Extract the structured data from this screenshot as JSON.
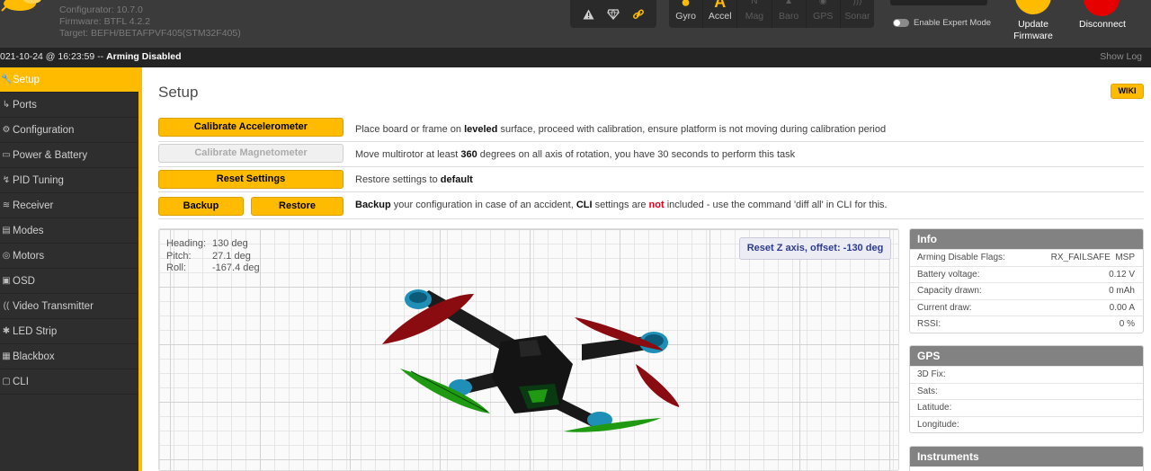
{
  "app": {
    "configurator_version": "Configurator: 10.7.0",
    "firmware": "Firmware: BTFL 4.2.2",
    "target": "Target: BEFH/BETAFPVF405(STM32F405)"
  },
  "header": {
    "status_icons": [
      "warning-icon",
      "shield-icon",
      "link-icon"
    ],
    "sensors": [
      {
        "label": "Gyro",
        "active": true
      },
      {
        "label": "Accel",
        "active": true
      },
      {
        "label": "Mag",
        "active": false
      },
      {
        "label": "Baro",
        "active": false
      },
      {
        "label": "GPS",
        "active": false
      },
      {
        "label": "Sonar",
        "active": false
      }
    ],
    "expert_mode_label": "Enable Expert Mode",
    "update_firmware_label_1": "Update",
    "update_firmware_label_2": "Firmware",
    "disconnect_label": "Disconnect"
  },
  "statusbar": {
    "log_timestamp": "021-10-24 @ 16:23:59 -- ",
    "log_message": "Arming Disabled",
    "show_log": "Show Log"
  },
  "sidebar": {
    "items": [
      {
        "label": "Setup",
        "icon": "wrench-icon",
        "glyph": "🔧",
        "active": true
      },
      {
        "label": "Ports",
        "icon": "ports-icon",
        "glyph": "↳",
        "active": false
      },
      {
        "label": "Configuration",
        "icon": "gear-icon",
        "glyph": "⚙",
        "active": false
      },
      {
        "label": "Power & Battery",
        "icon": "battery-icon",
        "glyph": "▭",
        "active": false
      },
      {
        "label": "PID Tuning",
        "icon": "pid-icon",
        "glyph": "↯",
        "active": false
      },
      {
        "label": "Receiver",
        "icon": "receiver-icon",
        "glyph": "≋",
        "active": false
      },
      {
        "label": "Modes",
        "icon": "modes-icon",
        "glyph": "▤",
        "active": false
      },
      {
        "label": "Motors",
        "icon": "motor-icon",
        "glyph": "◎",
        "active": false
      },
      {
        "label": "OSD",
        "icon": "osd-icon",
        "glyph": "▣",
        "active": false
      },
      {
        "label": "Video Transmitter",
        "icon": "vtx-icon",
        "glyph": "((",
        "active": false
      },
      {
        "label": "LED Strip",
        "icon": "led-icon",
        "glyph": "✱",
        "active": false
      },
      {
        "label": "Blackbox",
        "icon": "blackbox-icon",
        "glyph": "▦",
        "active": false
      },
      {
        "label": "CLI",
        "icon": "cli-icon",
        "glyph": "▢",
        "active": false
      }
    ]
  },
  "setup": {
    "title": "Setup",
    "wiki_label": "WIKI",
    "calibrate_acc_label": "Calibrate Accelerometer",
    "calibrate_acc_desc_1": "Place board or frame on ",
    "calibrate_acc_desc_bold": "leveled",
    "calibrate_acc_desc_2": " surface, proceed with calibration, ensure platform is not moving during calibration period",
    "calibrate_mag_label": "Calibrate Magnetometer",
    "calibrate_mag_desc_1": "Move multirotor at least ",
    "calibrate_mag_desc_bold": "360",
    "calibrate_mag_desc_2": " degrees on all axis of rotation, you have 30 seconds to perform this task",
    "reset_label": "Reset Settings",
    "reset_desc_1": "Restore settings to ",
    "reset_desc_bold": "default",
    "backup_label": "Backup",
    "restore_label": "Restore",
    "backup_desc_b1": "Backup",
    "backup_desc_1": " your configuration in case of an accident, ",
    "backup_desc_b2": "CLI",
    "backup_desc_2": " settings are ",
    "backup_desc_not": "not",
    "backup_desc_3": " included - use the command 'diff all' in CLI for this."
  },
  "attitude": {
    "heading_label": "Heading:",
    "heading_value": "130 deg",
    "pitch_label": "Pitch:",
    "pitch_value": "27.1 deg",
    "roll_label": "Roll:",
    "roll_value": "-167.4 deg",
    "reset_z_label": "Reset Z axis, offset: -130 deg"
  },
  "info": {
    "title": "Info",
    "rows": [
      {
        "label": "Arming Disable Flags:",
        "value": "RX_FAILSAFE  MSP"
      },
      {
        "label": "Battery voltage:",
        "value": "0.12 V"
      },
      {
        "label": "Capacity drawn:",
        "value": "0 mAh"
      },
      {
        "label": "Current draw:",
        "value": "0.00 A"
      },
      {
        "label": "RSSI:",
        "value": "0 %"
      }
    ]
  },
  "gps": {
    "title": "GPS",
    "rows": [
      {
        "label": "3D Fix:",
        "value": ""
      },
      {
        "label": "Sats:",
        "value": ""
      },
      {
        "label": "Latitude:",
        "value": ""
      },
      {
        "label": "Longitude:",
        "value": ""
      }
    ]
  },
  "instruments": {
    "title": "Instruments"
  },
  "colors": {
    "accent": "#ffbb00",
    "header_bg": "#3b3b3b",
    "disconnect": "#e60000",
    "prop_red": "#8a0c10",
    "prop_green": "#1f9a12",
    "motor_blue": "#1f8fb8"
  }
}
